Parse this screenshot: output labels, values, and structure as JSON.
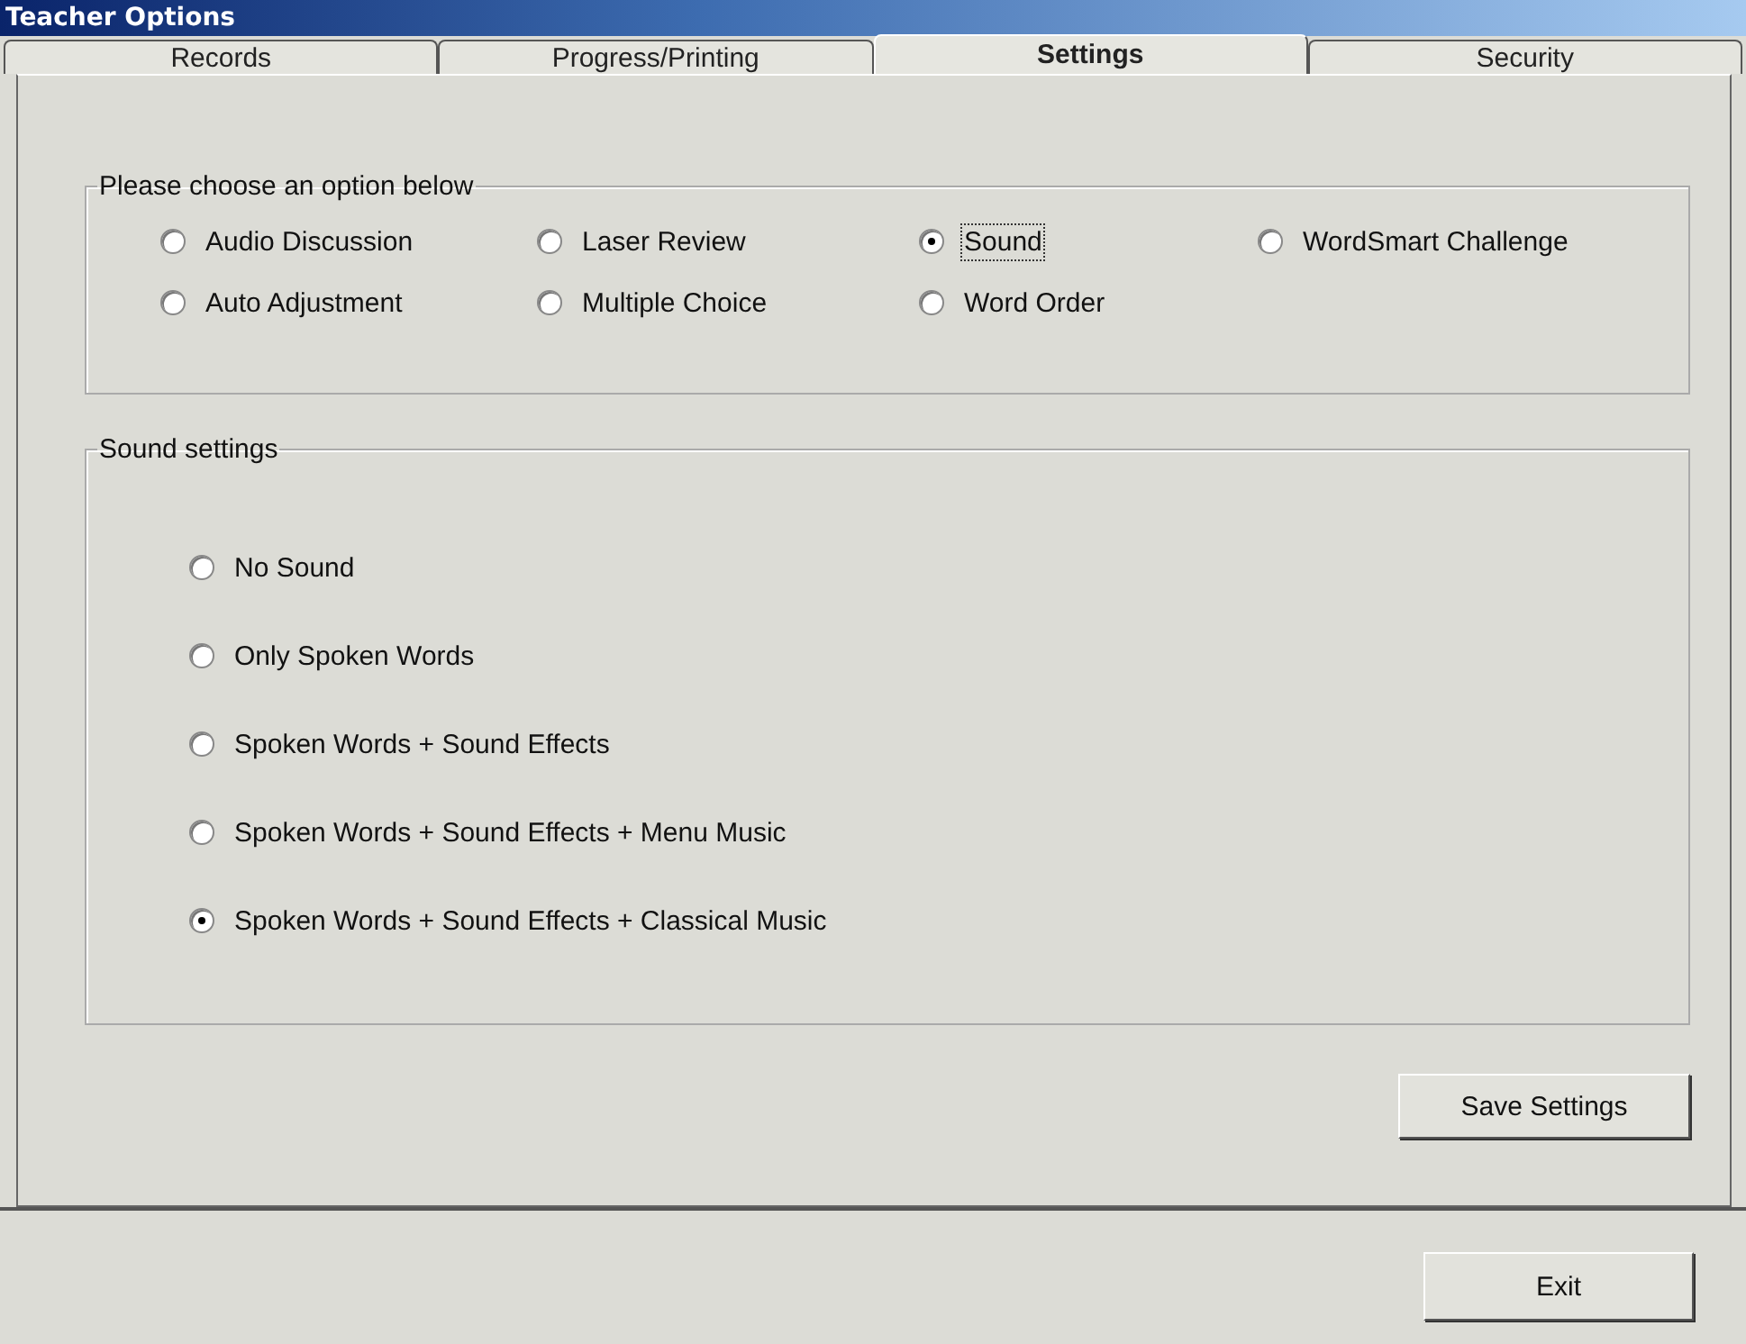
{
  "window": {
    "title": "Teacher Options"
  },
  "tabs": [
    {
      "label": "Records",
      "selected": false
    },
    {
      "label": "Progress/Printing",
      "selected": false
    },
    {
      "label": "Settings",
      "selected": true
    },
    {
      "label": "Security",
      "selected": false
    }
  ],
  "option_group": {
    "title": "Please choose an option below",
    "options": [
      {
        "label": "Audio Discussion",
        "selected": false,
        "focused": false
      },
      {
        "label": "Laser Review",
        "selected": false,
        "focused": false
      },
      {
        "label": "Sound",
        "selected": true,
        "focused": true
      },
      {
        "label": "WordSmart Challenge",
        "selected": false,
        "focused": false
      },
      {
        "label": "Auto Adjustment",
        "selected": false,
        "focused": false
      },
      {
        "label": "Multiple Choice",
        "selected": false,
        "focused": false
      },
      {
        "label": "Word Order",
        "selected": false,
        "focused": false
      }
    ]
  },
  "sound_group": {
    "title": "Sound settings",
    "options": [
      {
        "label": "No Sound",
        "selected": false
      },
      {
        "label": "Only Spoken Words",
        "selected": false
      },
      {
        "label": "Spoken Words + Sound Effects",
        "selected": false
      },
      {
        "label": "Spoken Words + Sound Effects + Menu Music",
        "selected": false
      },
      {
        "label": "Spoken Words + Sound Effects + Classical Music",
        "selected": true
      }
    ]
  },
  "save_button": {
    "label": "Save Settings"
  },
  "exit_button": {
    "label": "Exit"
  }
}
